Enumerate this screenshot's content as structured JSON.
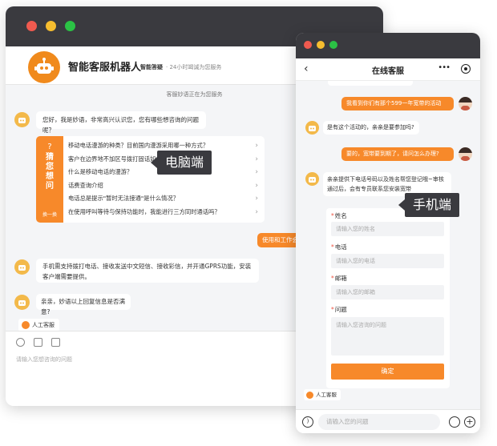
{
  "desktop": {
    "title": "智能客服机器人",
    "subtitle_bold": "智能答疑",
    "subtitle": "· 24小时竭诚为您服务",
    "system_note": "客服妙语正在为您服务",
    "greeting": "您好，我是妙语，非常高兴认识您，您有哪些想咨询的问题呢？",
    "faq_side_title": "猜您想问",
    "faq_side_switch": "换一换",
    "faq_items": [
      "移动电话漫游的种类？目前国内漫游采用哪一种方式？",
      "客户在边界地不加区号拨打固话如何处理？",
      "什么是移动电话的漫游？",
      "话费查询介绍",
      "电话总是提示\"暂时无法接通\"是什么情况？",
      "在使用呼叫等待与保持功能时，我能进行三方同时通话吗？"
    ],
    "user_msg": "使用和工作会",
    "bot_reply": "手机需支持拨打电话、接收发送中文短信、接收彩信，并开通GPRS功能，安装客户端需要提供。",
    "bot_followup": "亲亲，妙语以上回复信息是否满意?",
    "human_button": "人工客服",
    "input_placeholder": "请输入您想咨询的问题",
    "tag": "电脑端"
  },
  "mobile": {
    "title": "在线客服",
    "more_icon": "•••",
    "user_msg_1": "我看到你们有那个599一年宽带的活动",
    "bot_msg_1": "是有这个活动的，亲亲是要参加吗?",
    "user_msg_2": "要的，宽带要到期了，请问怎么办理?",
    "bot_msg_2": "亲亲提供下电话号码以及姓名帮您登记哦~审核通过后，会有专员联系您安装宽带",
    "form": {
      "name_label": "姓名",
      "name_placeholder": "请输入您的姓名",
      "phone_label": "电话",
      "phone_placeholder": "请输入您的电话",
      "email_label": "邮箱",
      "email_placeholder": "请输入您的邮箱",
      "question_label": "问题",
      "question_placeholder": "请输入您咨询的问题",
      "submit": "确定"
    },
    "human_button": "人工客服",
    "input_placeholder": "请输入您的问题",
    "tag": "手机端"
  },
  "colors": {
    "accent": "#f7892a",
    "titlebar": "#3a3a3f",
    "bg": "#f4f5f7"
  },
  "icons": [
    "robot-icon",
    "back-arrow-icon",
    "more-icon",
    "target-icon",
    "voice-icon",
    "emoji-icon",
    "plus-icon",
    "image-icon",
    "folder-icon",
    "chevron-right-icon"
  ]
}
